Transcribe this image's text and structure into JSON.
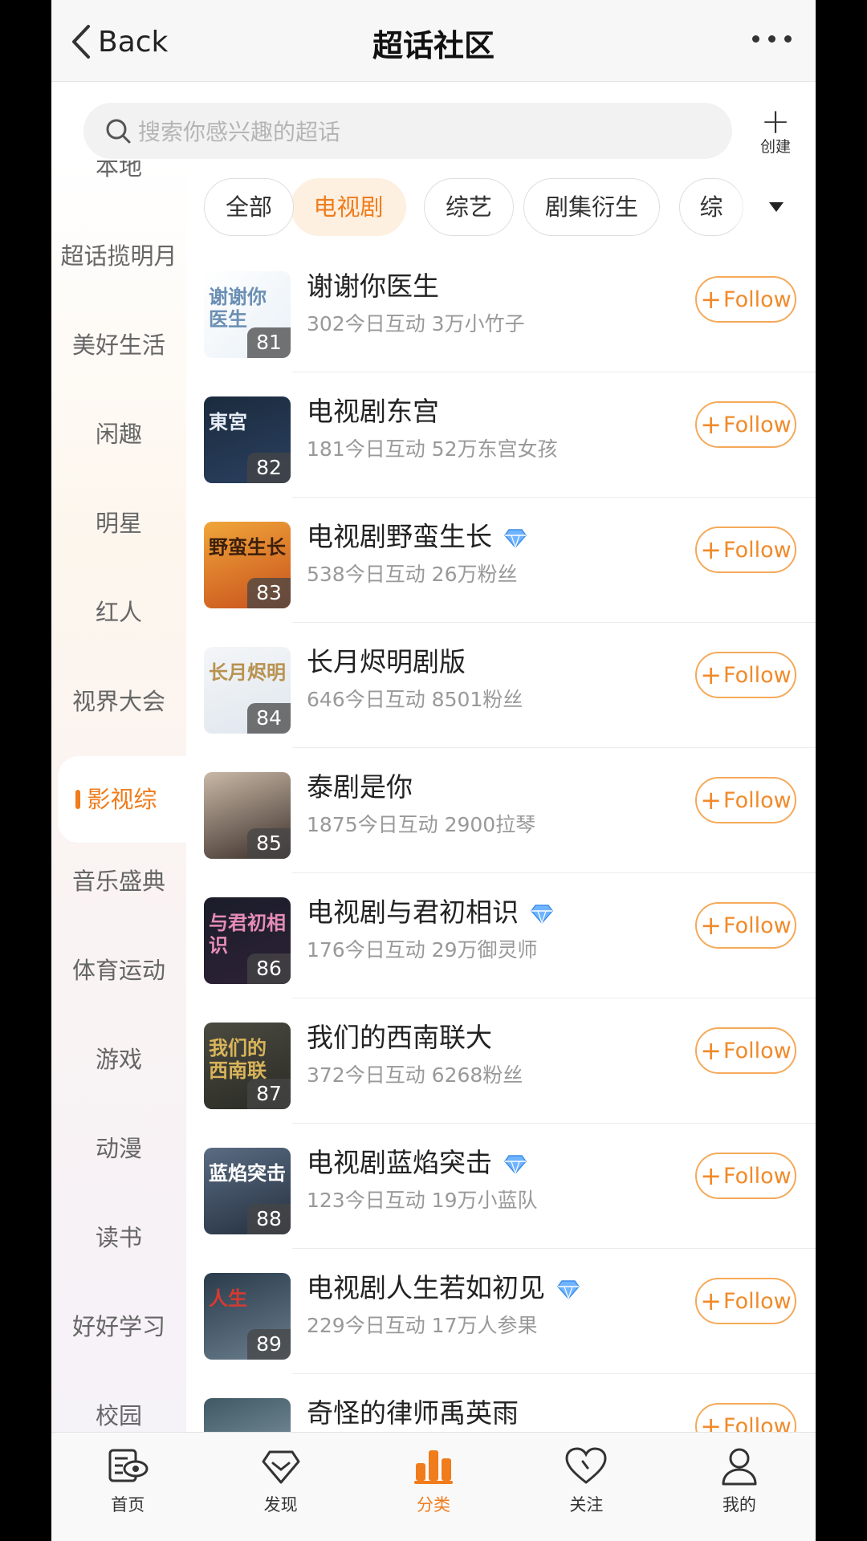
{
  "header": {
    "back_label": "Back",
    "title": "超话社区"
  },
  "search": {
    "placeholder": "搜索你感兴趣的超话",
    "create_label": "创建"
  },
  "sidebar": {
    "items": [
      {
        "label": "本地"
      },
      {
        "label": "超话揽明月"
      },
      {
        "label": "美好生活"
      },
      {
        "label": "闲趣"
      },
      {
        "label": "明星"
      },
      {
        "label": "红人"
      },
      {
        "label": "视界大会"
      },
      {
        "label": "影视综",
        "active": true
      },
      {
        "label": "音乐盛典"
      },
      {
        "label": "体育运动"
      },
      {
        "label": "游戏"
      },
      {
        "label": "动漫"
      },
      {
        "label": "读书"
      },
      {
        "label": "好好学习"
      },
      {
        "label": "校园"
      }
    ]
  },
  "chips": [
    {
      "label": "全部"
    },
    {
      "label": "电视剧",
      "active": true
    },
    {
      "label": "综艺"
    },
    {
      "label": "剧集衍生"
    },
    {
      "label": "综"
    }
  ],
  "follow_label": "Follow",
  "list": [
    {
      "rank": "81",
      "name": "谢谢你医生",
      "meta": "302今日互动 3万小竹子",
      "verified": false,
      "art": "谢谢你 医生"
    },
    {
      "rank": "82",
      "name": "电视剧东宫",
      "meta": "181今日互动 52万东宫女孩",
      "verified": false,
      "art": "東宮"
    },
    {
      "rank": "83",
      "name": "电视剧野蛮生长",
      "meta": "538今日互动 26万粉丝",
      "verified": true,
      "art": "野蛮生长"
    },
    {
      "rank": "84",
      "name": "长月烬明剧版",
      "meta": "646今日互动 8501粉丝",
      "verified": false,
      "art": "长月烬明"
    },
    {
      "rank": "85",
      "name": "泰剧是你",
      "meta": "1875今日互动 2900拉琴",
      "verified": false,
      "art": ""
    },
    {
      "rank": "86",
      "name": "电视剧与君初相识",
      "meta": "176今日互动 29万御灵师",
      "verified": true,
      "art": "与君初相识"
    },
    {
      "rank": "87",
      "name": "我们的西南联大",
      "meta": "372今日互动 6268粉丝",
      "verified": false,
      "art": "我们的 西南联"
    },
    {
      "rank": "88",
      "name": "电视剧蓝焰突击",
      "meta": "123今日互动 19万小蓝队",
      "verified": true,
      "art": "蓝焰突击"
    },
    {
      "rank": "89",
      "name": "电视剧人生若如初见",
      "meta": "229今日互动 17万人参果",
      "verified": true,
      "art": "人生"
    },
    {
      "rank": "",
      "name": "奇怪的律师禹英雨",
      "meta": "",
      "verified": false,
      "art": ""
    }
  ],
  "tabbar": [
    {
      "label": "首页",
      "icon": "home-icon"
    },
    {
      "label": "发现",
      "icon": "discover-icon"
    },
    {
      "label": "分类",
      "icon": "category-icon",
      "active": true
    },
    {
      "label": "关注",
      "icon": "heart-icon"
    },
    {
      "label": "我的",
      "icon": "profile-icon"
    }
  ],
  "colors": {
    "accent": "#f07c1c",
    "follow_border": "#f5a95a",
    "verified": "#4a9fff"
  }
}
